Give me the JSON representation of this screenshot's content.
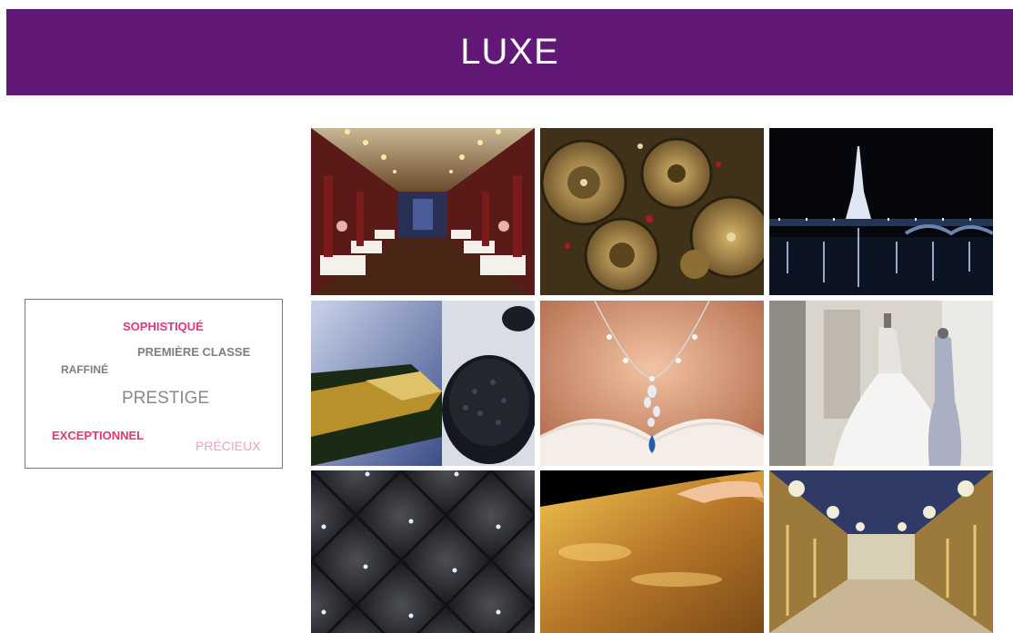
{
  "header": {
    "title": "LUXE"
  },
  "word_cloud": {
    "words": [
      {
        "text": "SOPHISTIQUÉ",
        "color": "#e6357a"
      },
      {
        "text": "PREMIÈRE CLASSE",
        "color": "#7f7f7f"
      },
      {
        "text": "RAFFINÉ",
        "color": "#7f7f7f"
      },
      {
        "text": "PRESTIGE",
        "color": "#8a8a8a"
      },
      {
        "text": "EXCEPTIONNEL",
        "color": "#e6357a"
      },
      {
        "text": "PRÉCIEUX",
        "color": "#f0a0c4"
      }
    ]
  },
  "gallery": {
    "photos": [
      {
        "subject": "luxury-train-dining-car"
      },
      {
        "subject": "watch-movement-gears"
      },
      {
        "subject": "eiffel-tower-night"
      },
      {
        "subject": "champagne-and-caviar"
      },
      {
        "subject": "pearl-necklace"
      },
      {
        "subject": "wedding-dresses"
      },
      {
        "subject": "tufted-leather"
      },
      {
        "subject": "gold-leaf"
      },
      {
        "subject": "hall-of-mirrors"
      }
    ]
  },
  "colors": {
    "banner": "#621975",
    "accent_pink": "#e6357a",
    "text_gray": "#7f7f7f"
  }
}
